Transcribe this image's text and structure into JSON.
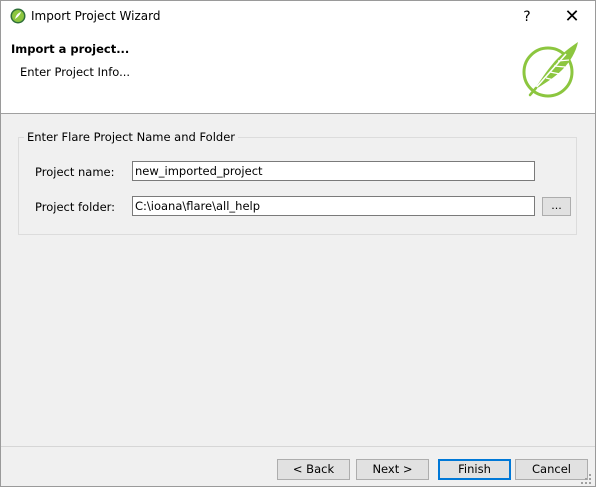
{
  "window": {
    "title": "Import Project Wizard",
    "help_label": "?",
    "close_label": "✕"
  },
  "banner": {
    "title": "Import a project...",
    "subtitle": "Enter Project Info...",
    "logo_icon": "madcap-flare-feather-icon",
    "accent_color": "#8cc63f"
  },
  "group": {
    "legend": "Enter Flare Project Name and Folder",
    "project_name_label": "Project name:",
    "project_name_value": "new_imported_project",
    "project_folder_label": "Project folder:",
    "project_folder_value": "C:\\ioana\\flare\\all_help",
    "browse_label": "..."
  },
  "buttons": {
    "back": "< Back",
    "next": "Next >",
    "finish": "Finish",
    "cancel": "Cancel",
    "default_color": "#0078d7"
  }
}
